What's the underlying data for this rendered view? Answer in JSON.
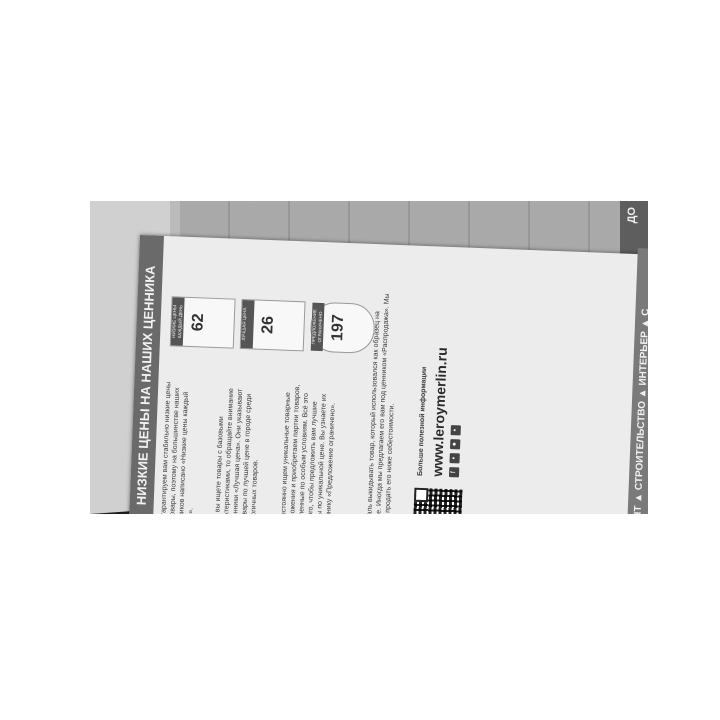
{
  "flyer": {
    "header": "НИЗКИЕ ЦЕНЫ НА НАШИХ ЦЕННИКА",
    "intro": "Мы гарантируем вам стабильно низкие цены на товары, поэтому на большинстве наших ценников написано «Низкие цены каждый день».",
    "best_price_text": "Если вы ищете товары с базовыми характеристиками, то обращайте внимание на ценники «Лучшая цена». Они указывают на товары по лучшей цене в городе среди аналогичных товаров.",
    "unique_text": "Мы постоянно ищем уникальные товарные предложения и приобретаем партии товаров, закупленные по особым условиям. Всё это для того, чтобы предложить вам лучшие товары по уникальной цене. Вы узнаете их по ценнику «Предложение ограничено».",
    "display_text": "Нам жаль выкидывать товар, который использовался как образец на витрине. Иногда мы предлагаем его вам под ценником «Распродажа». Мы можем продать его ниже себестоимости.",
    "more_info": "Больше полезной информации",
    "url": "www.leroymerlin.ru",
    "footer": "РЕМОНТ ▲ СТРОИТЕЛЬСТВО ▲ ИНТЕРЬЕР ▲ С",
    "side_tab": "ДО",
    "prices": [
      "62",
      "26",
      "197"
    ],
    "price_labels": [
      "НИЗКИЕ ЦЕНЫ КАЖДЫЙ ДЕНЬ",
      "ЛУЧШАЯ ЦЕНА",
      "ПРЕДЛОЖЕНИЕ ОГРАНИЧЕНО"
    ]
  }
}
